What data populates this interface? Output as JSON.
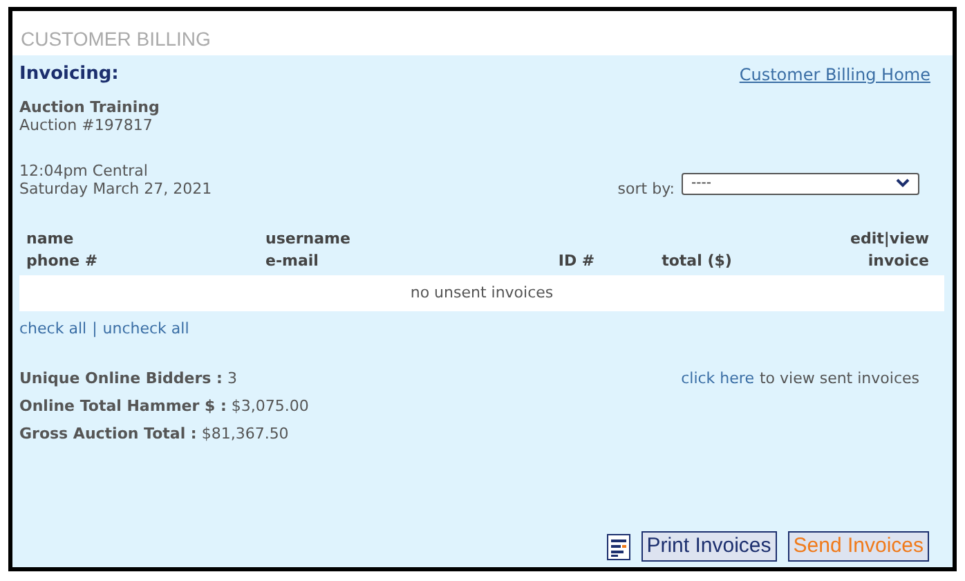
{
  "panel": {
    "title": "CUSTOMER BILLING"
  },
  "heading": "Invoicing:",
  "home_link": "Customer Billing Home",
  "auction": {
    "name": "Auction Training",
    "number": "Auction #197817"
  },
  "time": "12:04pm Central",
  "date": "Saturday March 27, 2021",
  "sort": {
    "label": "sort by:",
    "value": "----"
  },
  "table": {
    "columns": [
      [
        "name",
        "phone #"
      ],
      [
        "username",
        "e-mail"
      ],
      [
        "ID #"
      ],
      [
        "total ($)"
      ],
      [
        "edit|view",
        "invoice"
      ]
    ],
    "empty": "no unsent invoices"
  },
  "check_all": "check all",
  "separator": "|",
  "uncheck_all": "uncheck all",
  "stats": [
    {
      "label": "Unique Online Bidders :",
      "value": "3"
    },
    {
      "label": "Online Total Hammer $ :",
      "value": "$3,075.00"
    },
    {
      "label": "Gross Auction Total :",
      "value": "$81,367.50"
    }
  ],
  "sent_link": {
    "link": "click here",
    "text": "to view sent invoices"
  },
  "buttons": [
    {
      "label": "Print Invoices",
      "kind": "print"
    },
    {
      "label": "Send Invoices",
      "kind": "send"
    }
  ]
}
